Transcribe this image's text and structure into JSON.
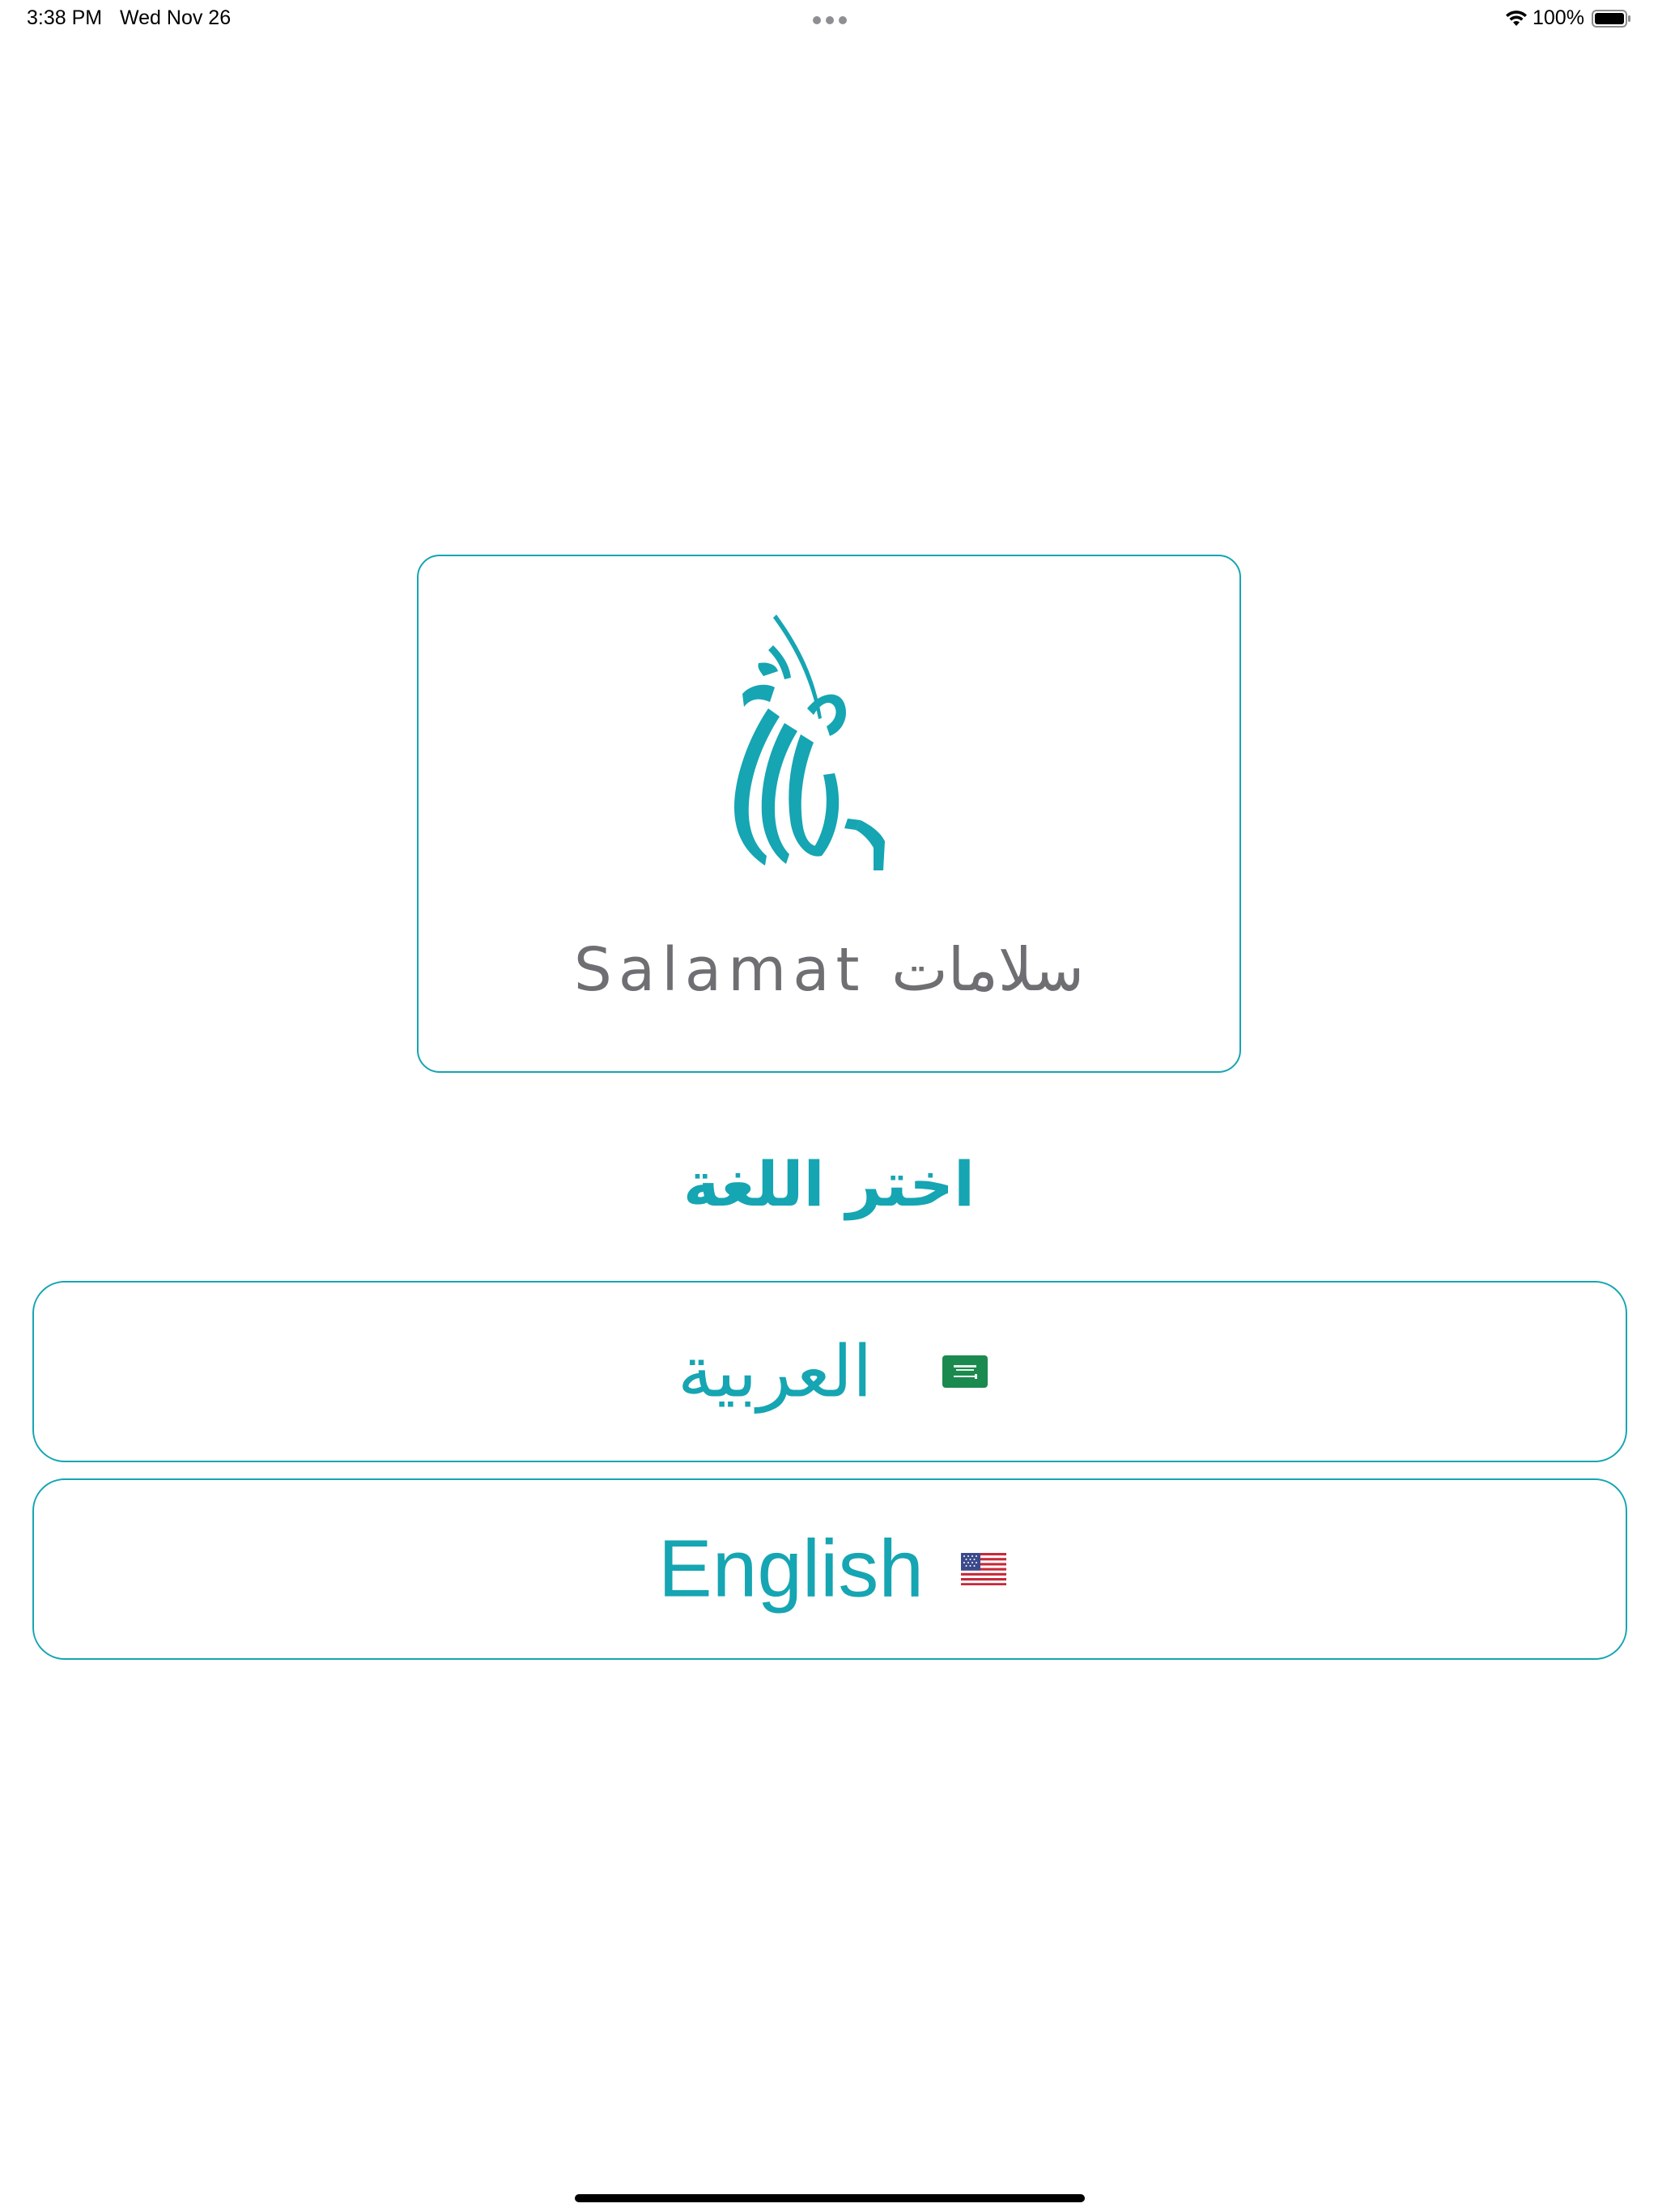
{
  "status_bar": {
    "time": "3:38 PM",
    "date": "Wed Nov 26",
    "battery": "100%",
    "wifi_icon": "wifi-icon",
    "battery_icon": "battery-full-icon"
  },
  "logo": {
    "wordmark": "Salamat سلامات",
    "mark_icon": "salamat-calligraphy-logo"
  },
  "heading": {
    "title": "اختر اللغة"
  },
  "languages": [
    {
      "label": "العربية",
      "flag_icon": "saudi-flag-icon"
    },
    {
      "label": "English",
      "flag_icon": "us-flag-icon"
    }
  ],
  "colors": {
    "accent": "#16a5b2",
    "wordmark": "#6f6f73",
    "background": "#ffffff"
  }
}
